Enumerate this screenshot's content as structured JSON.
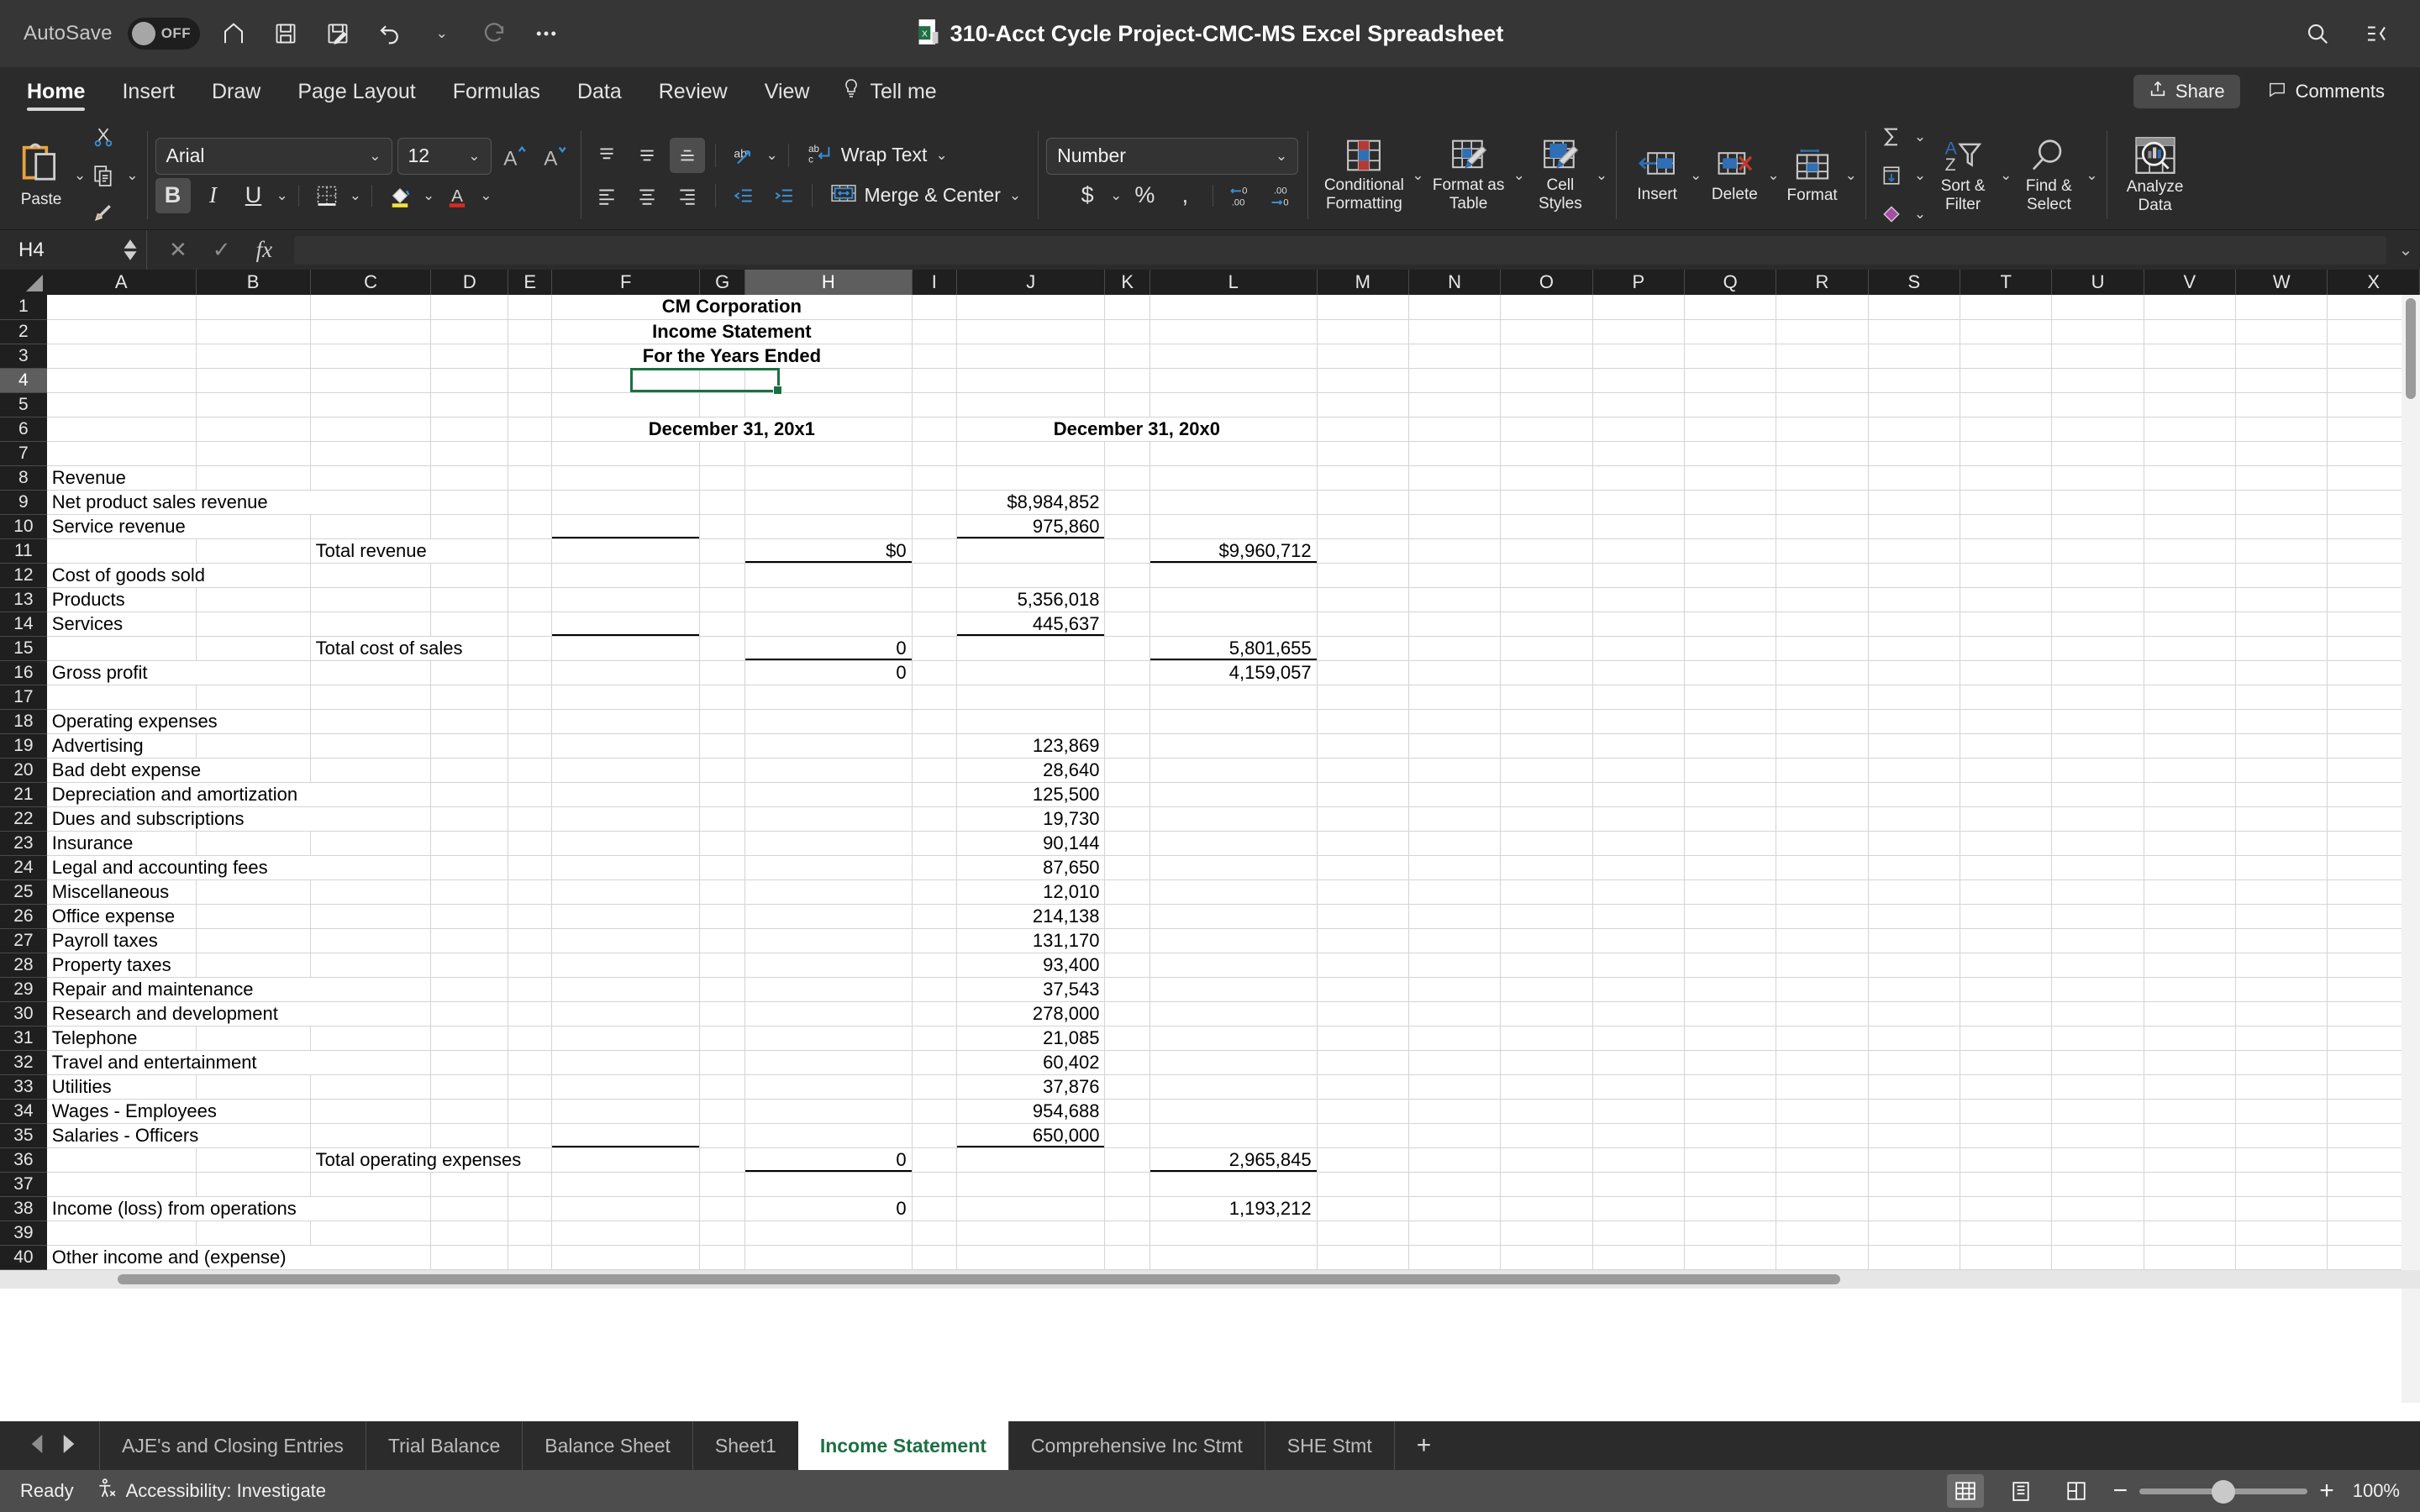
{
  "titlebar": {
    "autosave_label": "AutoSave",
    "autosave_state": "OFF",
    "document_title": "310-Acct Cycle Project-CMC-MS Excel Spreadsheet",
    "quick_access": [
      "home-icon",
      "save-icon",
      "save-as-icon",
      "undo-icon",
      "redo-icon",
      "more-icon"
    ],
    "right_icons": [
      "search-icon",
      "ribbon-display-icon"
    ]
  },
  "ribbon": {
    "tabs": [
      {
        "label": "Home",
        "active": true
      },
      {
        "label": "Insert",
        "active": false
      },
      {
        "label": "Draw",
        "active": false
      },
      {
        "label": "Page Layout",
        "active": false
      },
      {
        "label": "Formulas",
        "active": false
      },
      {
        "label": "Data",
        "active": false
      },
      {
        "label": "Review",
        "active": false
      },
      {
        "label": "View",
        "active": false
      }
    ],
    "tell_me": "Tell me",
    "share_label": "Share",
    "comments_label": "Comments",
    "clipboard": {
      "paste_label": "Paste",
      "cut_icon": "scissors-icon",
      "copy_icon": "copy-icon",
      "format_painter_icon": "format-painter-icon"
    },
    "font": {
      "family_value": "Arial",
      "size_value": "12",
      "grow_label": "A",
      "shrink_label": "A",
      "bold_label": "B",
      "italic_label": "I",
      "underline_label": "U",
      "borders_icon": "borders-icon",
      "fill_color_icon": "fill-color-icon",
      "font_color_icon": "font-color-icon"
    },
    "alignment": {
      "wrap_text_label": "Wrap Text",
      "merge_center_label": "Merge & Center",
      "orientation_icon": "text-orientation-icon",
      "indent_decrease_icon": "decrease-indent-icon",
      "indent_increase_icon": "increase-indent-icon"
    },
    "number": {
      "format_value": "Number",
      "currency_icon": "currency-icon",
      "percent_icon": "percent-icon",
      "comma_icon": "comma-style-icon",
      "increase_decimal_icon": "increase-decimal-icon",
      "decrease_decimal_icon": "decrease-decimal-icon"
    },
    "styles": {
      "conditional_formatting_label": "Conditional Formatting",
      "format_as_table_label": "Format as Table",
      "cell_styles_label": "Cell Styles"
    },
    "cells": {
      "insert_label": "Insert",
      "delete_label": "Delete",
      "format_label": "Format"
    },
    "editing": {
      "autosum_icon": "autosum-icon",
      "fill_icon": "fill-icon",
      "clear_icon": "clear-icon",
      "sort_filter_label": "Sort & Filter",
      "find_select_label": "Find & Select"
    },
    "analysis": {
      "analyze_data_label": "Analyze Data"
    }
  },
  "formula_bar": {
    "name_box_value": "H4",
    "cancel_icon": "cancel-icon",
    "enter_icon": "enter-icon",
    "function_icon": "fx-icon",
    "formula_value": ""
  },
  "grid": {
    "selected_cell": "H4",
    "columns": [
      {
        "label": "A",
        "width": 128
      },
      {
        "label": "B",
        "width": 122
      },
      {
        "label": "C",
        "width": 122
      },
      {
        "label": "D",
        "width": 78
      },
      {
        "label": "E",
        "width": 44
      },
      {
        "label": "F",
        "width": 158
      },
      {
        "label": "G",
        "width": 48
      },
      {
        "label": "H",
        "width": 178
      },
      {
        "label": "I",
        "width": 48
      },
      {
        "label": "J",
        "width": 158
      },
      {
        "label": "K",
        "width": 48
      },
      {
        "label": "L",
        "width": 178
      },
      {
        "label": "M",
        "width": 98
      },
      {
        "label": "N",
        "width": 98
      },
      {
        "label": "O",
        "width": 98
      },
      {
        "label": "P",
        "width": 98
      },
      {
        "label": "Q",
        "width": 98
      },
      {
        "label": "R",
        "width": 98
      },
      {
        "label": "S",
        "width": 98
      },
      {
        "label": "T",
        "width": 98
      },
      {
        "label": "U",
        "width": 98
      },
      {
        "label": "V",
        "width": 98
      },
      {
        "label": "W",
        "width": 98
      },
      {
        "label": "X",
        "width": 98
      }
    ],
    "rows": [
      {
        "n": 1,
        "cells": {
          "F": {
            "v": "CM Corporation",
            "b": true,
            "span": 3,
            "align": "c"
          }
        }
      },
      {
        "n": 2,
        "cells": {
          "F": {
            "v": "Income Statement",
            "b": true,
            "span": 3,
            "align": "c"
          }
        }
      },
      {
        "n": 3,
        "cells": {
          "F": {
            "v": "For the Years Ended",
            "b": true,
            "span": 3,
            "align": "c"
          }
        }
      },
      {
        "n": 4,
        "cells": {}
      },
      {
        "n": 5,
        "cells": {}
      },
      {
        "n": 6,
        "cells": {
          "F": {
            "v": "December 31, 20x1",
            "b": true,
            "span": 3,
            "align": "c"
          },
          "J": {
            "v": "December 31, 20x0",
            "b": true,
            "span": 3,
            "align": "c"
          }
        }
      },
      {
        "n": 7,
        "cells": {}
      },
      {
        "n": 8,
        "cells": {
          "A": {
            "v": "Revenue"
          }
        }
      },
      {
        "n": 9,
        "cells": {
          "A": {
            "v": "   Net product sales revenue",
            "span": 3
          },
          "J": {
            "v": "$8,984,852",
            "align": "r"
          }
        }
      },
      {
        "n": 10,
        "cells": {
          "A": {
            "v": "   Service revenue",
            "span": 2
          },
          "J": {
            "v": "975,860",
            "align": "r",
            "border": "bottom"
          },
          "F": {
            "v": "",
            "border": "bottom"
          }
        }
      },
      {
        "n": 11,
        "cells": {
          "C": {
            "v": "      Total revenue",
            "span": 2
          },
          "H": {
            "v": "$0",
            "align": "r",
            "border": "bottom"
          },
          "L": {
            "v": "$9,960,712",
            "align": "r",
            "border": "bottom"
          }
        }
      },
      {
        "n": 12,
        "cells": {
          "A": {
            "v": "Cost of goods sold",
            "span": 2
          }
        }
      },
      {
        "n": 13,
        "cells": {
          "A": {
            "v": "   Products"
          },
          "J": {
            "v": "5,356,018",
            "align": "r"
          }
        }
      },
      {
        "n": 14,
        "cells": {
          "A": {
            "v": "   Services"
          },
          "J": {
            "v": "445,637",
            "align": "r",
            "border": "bottom"
          },
          "F": {
            "v": "",
            "border": "bottom"
          }
        }
      },
      {
        "n": 15,
        "cells": {
          "C": {
            "v": "      Total cost of sales",
            "span": 2
          },
          "H": {
            "v": "0",
            "align": "r",
            "border": "bottom"
          },
          "L": {
            "v": "5,801,655",
            "align": "r",
            "border": "bottom"
          }
        }
      },
      {
        "n": 16,
        "cells": {
          "A": {
            "v": "Gross profit",
            "span": 2
          },
          "H": {
            "v": "0",
            "align": "r"
          },
          "L": {
            "v": "4,159,057",
            "align": "r"
          }
        }
      },
      {
        "n": 17,
        "cells": {}
      },
      {
        "n": 18,
        "cells": {
          "A": {
            "v": "Operating expenses",
            "span": 2
          }
        }
      },
      {
        "n": 19,
        "cells": {
          "A": {
            "v": "   Advertising"
          },
          "J": {
            "v": "123,869",
            "align": "r"
          }
        }
      },
      {
        "n": 20,
        "cells": {
          "A": {
            "v": "   Bad debt expense",
            "span": 2
          },
          "J": {
            "v": "28,640",
            "align": "r"
          }
        }
      },
      {
        "n": 21,
        "cells": {
          "A": {
            "v": "   Depreciation and amortization",
            "span": 3
          },
          "J": {
            "v": "125,500",
            "align": "r"
          }
        }
      },
      {
        "n": 22,
        "cells": {
          "A": {
            "v": "   Dues and subscriptions",
            "span": 3
          },
          "J": {
            "v": "19,730",
            "align": "r"
          }
        }
      },
      {
        "n": 23,
        "cells": {
          "A": {
            "v": "   Insurance"
          },
          "J": {
            "v": "90,144",
            "align": "r"
          }
        }
      },
      {
        "n": 24,
        "cells": {
          "A": {
            "v": "   Legal and accounting fees",
            "span": 3
          },
          "J": {
            "v": "87,650",
            "align": "r"
          }
        }
      },
      {
        "n": 25,
        "cells": {
          "A": {
            "v": "   Miscellaneous"
          },
          "J": {
            "v": "12,010",
            "align": "r"
          }
        }
      },
      {
        "n": 26,
        "cells": {
          "A": {
            "v": "   Office expense"
          },
          "J": {
            "v": "214,138",
            "align": "r"
          }
        }
      },
      {
        "n": 27,
        "cells": {
          "A": {
            "v": "   Payroll taxes"
          },
          "J": {
            "v": "131,170",
            "align": "r"
          }
        }
      },
      {
        "n": 28,
        "cells": {
          "A": {
            "v": "   Property taxes"
          },
          "J": {
            "v": "93,400",
            "align": "r"
          }
        }
      },
      {
        "n": 29,
        "cells": {
          "A": {
            "v": "   Repair and maintenance",
            "span": 3
          },
          "J": {
            "v": "37,543",
            "align": "r"
          }
        }
      },
      {
        "n": 30,
        "cells": {
          "A": {
            "v": "   Research and development",
            "span": 3
          },
          "J": {
            "v": "278,000",
            "align": "r"
          }
        }
      },
      {
        "n": 31,
        "cells": {
          "A": {
            "v": "   Telephone"
          },
          "J": {
            "v": "21,085",
            "align": "r"
          }
        }
      },
      {
        "n": 32,
        "cells": {
          "A": {
            "v": "   Travel and entertainment",
            "span": 3
          },
          "J": {
            "v": "60,402",
            "align": "r"
          }
        }
      },
      {
        "n": 33,
        "cells": {
          "A": {
            "v": "   Utilities"
          },
          "J": {
            "v": "37,876",
            "align": "r"
          }
        }
      },
      {
        "n": 34,
        "cells": {
          "A": {
            "v": "   Wages - Employees",
            "span": 2
          },
          "J": {
            "v": "954,688",
            "align": "r"
          }
        }
      },
      {
        "n": 35,
        "cells": {
          "A": {
            "v": "   Salaries - Officers",
            "span": 2
          },
          "J": {
            "v": "650,000",
            "align": "r",
            "border": "bottom"
          },
          "F": {
            "v": "",
            "border": "bottom"
          }
        }
      },
      {
        "n": 36,
        "cells": {
          "C": {
            "v": "      Total operating expenses",
            "span": 3
          },
          "H": {
            "v": "0",
            "align": "r",
            "border": "bottom"
          },
          "L": {
            "v": "2,965,845",
            "align": "r",
            "border": "bottom"
          }
        }
      },
      {
        "n": 37,
        "cells": {}
      },
      {
        "n": 38,
        "cells": {
          "A": {
            "v": "Income (loss) from operations",
            "span": 3
          },
          "H": {
            "v": "0",
            "align": "r"
          },
          "L": {
            "v": "1,193,212",
            "align": "r"
          }
        }
      },
      {
        "n": 39,
        "cells": {}
      },
      {
        "n": 40,
        "cells": {
          "A": {
            "v": "Other income and (expense)",
            "span": 3
          }
        }
      }
    ]
  },
  "sheet_tabs": {
    "tabs": [
      {
        "label": "AJE's and Closing Entries",
        "active": false
      },
      {
        "label": "Trial Balance",
        "active": false
      },
      {
        "label": "Balance Sheet",
        "active": false
      },
      {
        "label": "Sheet1",
        "active": false
      },
      {
        "label": "Income Statement",
        "active": true
      },
      {
        "label": "Comprehensive Inc Stmt",
        "active": false
      },
      {
        "label": "SHE Stmt",
        "active": false
      }
    ],
    "add_label": "+"
  },
  "statusbar": {
    "ready_label": "Ready",
    "accessibility_label": "Accessibility: Investigate",
    "zoom_value": "100%",
    "views": [
      "normal-view-icon",
      "page-layout-icon",
      "page-break-icon"
    ]
  }
}
